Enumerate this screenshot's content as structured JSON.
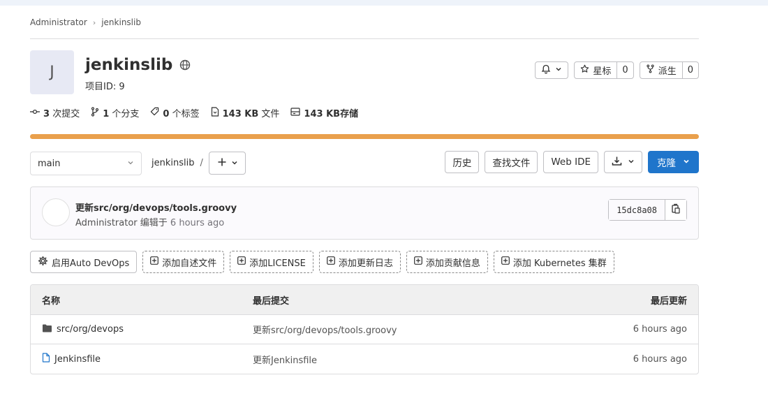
{
  "breadcrumb": {
    "parent": "Administrator",
    "current": "jenkinslib"
  },
  "project": {
    "avatar_letter": "J",
    "name": "jenkinslib",
    "id_label": "项目ID: 9"
  },
  "notifications": {
    "icon": "bell-icon"
  },
  "star": {
    "label": "星标",
    "count": "0"
  },
  "fork": {
    "label": "派生",
    "count": "0"
  },
  "stats": {
    "commits": {
      "value": "3",
      "label": "次提交"
    },
    "branches": {
      "value": "1",
      "label": "个分支"
    },
    "tags": {
      "value": "0",
      "label": "个标签"
    },
    "files": {
      "value": "143 KB",
      "label": "文件"
    },
    "storage": {
      "value": "143 KB",
      "label": "存储"
    }
  },
  "repo_bar": {
    "branch": "main",
    "path": "jenkinslib",
    "path_sep": "/",
    "history": "历史",
    "find_file": "查找文件",
    "web_ide": "Web IDE",
    "clone": "克隆"
  },
  "last_commit": {
    "title": "更新src/org/devops/tools.groovy",
    "author": "Administrator",
    "action": "编辑于",
    "time": "6 hours ago",
    "sha": "15dc8a08"
  },
  "quick_actions": {
    "auto_devops": "启用Auto DevOps",
    "readme": "添加自述文件",
    "license": "添加LICENSE",
    "changelog": "添加更新日志",
    "contributing": "添加贡献信息",
    "kubernetes": "添加 Kubernetes 集群"
  },
  "table": {
    "headers": {
      "name": "名称",
      "last_commit": "最后提交",
      "last_update": "最后更新"
    },
    "rows": [
      {
        "name": "src/org/devops",
        "icon": "folder-icon",
        "commit": "更新src/org/devops/tools.groovy",
        "updated": "6 hours ago"
      },
      {
        "name": "Jenkinsfile",
        "icon": "file-icon",
        "commit": "更新Jenkinsfile",
        "updated": "6 hours ago"
      }
    ]
  },
  "colors": {
    "accent": "#1f75cb",
    "progress": "#e9a04c"
  }
}
